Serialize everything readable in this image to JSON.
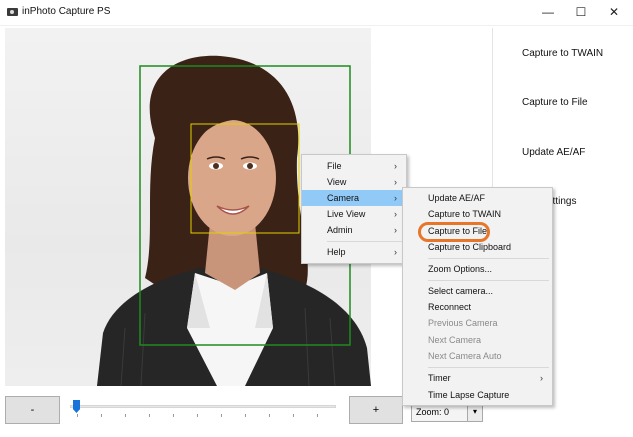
{
  "window": {
    "title": "inPhoto Capture PS",
    "minimize": "—",
    "maximize": "☐",
    "close": "✕"
  },
  "side_panel": {
    "capture_twain": "Capture to TWAIN",
    "capture_file": "Capture to File",
    "update_ae_af": "Update AE/AF",
    "settings": "settings"
  },
  "controls": {
    "minus": "-",
    "plus": "+",
    "zoom_label": "Zoom: 0",
    "zoom_arrow": "▾"
  },
  "main_menu": {
    "items": [
      {
        "label": "File",
        "arrow": "›"
      },
      {
        "label": "View",
        "arrow": "›"
      },
      {
        "label": "Camera",
        "arrow": "›"
      },
      {
        "label": "Live View",
        "arrow": "›"
      },
      {
        "label": "Admin",
        "arrow": "›"
      },
      {
        "label": "Help",
        "arrow": "›"
      }
    ]
  },
  "camera_menu": {
    "items": [
      {
        "label": "Update AE/AF"
      },
      {
        "label": "Capture to TWAIN"
      },
      {
        "label": "Capture to File"
      },
      {
        "label": "Capture to Clipboard"
      },
      {
        "label": "Zoom Options..."
      },
      {
        "label": "Select camera..."
      },
      {
        "label": "Reconnect"
      },
      {
        "label": "Previous Camera"
      },
      {
        "label": "Next Camera"
      },
      {
        "label": "Next Camera Auto"
      },
      {
        "label": "Timer",
        "arrow": "›"
      },
      {
        "label": "Time Lapse Capture"
      }
    ]
  },
  "colors": {
    "menu_highlight": "#91c9f7",
    "crop_frame": "#1e8a1e",
    "face_frame": "#e6d000",
    "callout_ring": "#e8762a",
    "slider_thumb": "#1a73d9"
  }
}
